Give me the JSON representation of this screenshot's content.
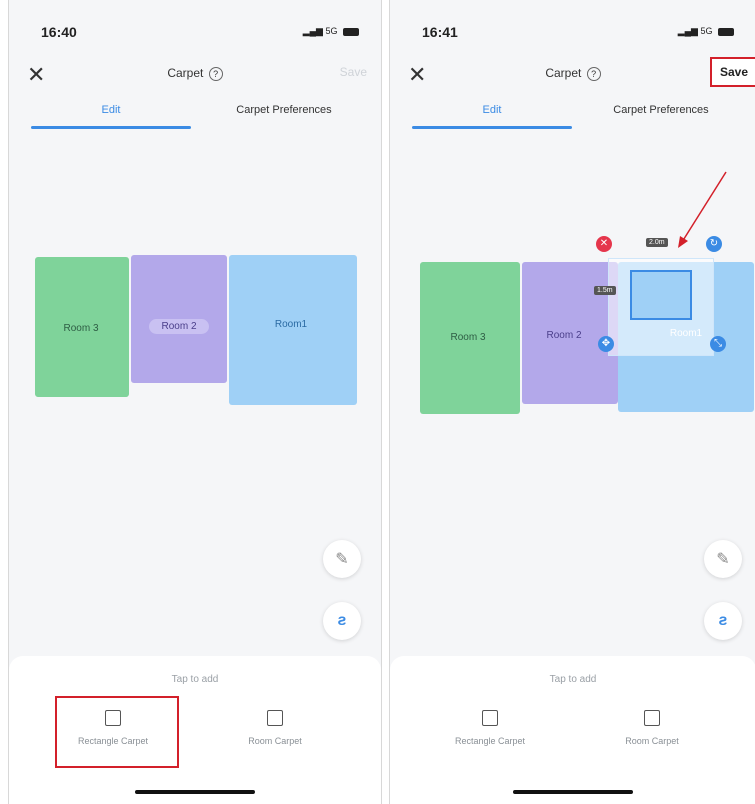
{
  "screens": [
    {
      "status": {
        "time": "16:40",
        "network": "5G"
      },
      "nav": {
        "title": "Carpet",
        "help_icon": "?",
        "save_label": "Save",
        "close_icon": "✕"
      },
      "tabs": {
        "edit": "Edit",
        "preferences": "Carpet Preferences"
      },
      "rooms": {
        "room3": "Room 3",
        "room2": "Room 2",
        "room1": "Room1"
      },
      "sheet": {
        "hint": "Tap to add",
        "rect_carpet": "Rectangle Carpet",
        "room_carpet": "Room Carpet"
      }
    },
    {
      "status": {
        "time": "16:41",
        "network": "5G"
      },
      "nav": {
        "title": "Carpet",
        "help_icon": "?",
        "save_label": "Save",
        "close_icon": "✕"
      },
      "tabs": {
        "edit": "Edit",
        "preferences": "Carpet Preferences"
      },
      "rooms": {
        "room3": "Room 3",
        "room2": "Room 2",
        "room1": "Room1"
      },
      "carpet": {
        "width_tag": "2.0m",
        "height_tag": "1.5m"
      },
      "sheet": {
        "hint": "Tap to add",
        "rect_carpet": "Rectangle Carpet",
        "room_carpet": "Room Carpet"
      }
    }
  ],
  "colors": {
    "room3": "#7fd39a",
    "room2": "#b3a8ea",
    "room1": "#9fd0f6",
    "accent": "#3b8be4",
    "highlight": "#d3202a"
  }
}
